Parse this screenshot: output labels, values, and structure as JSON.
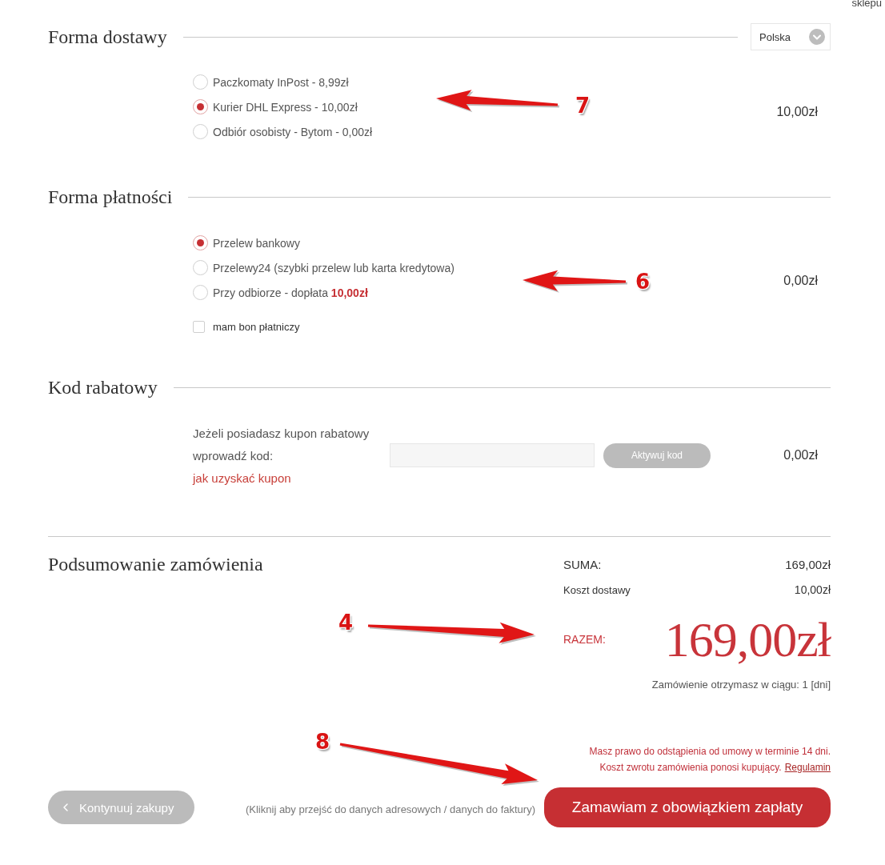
{
  "top_link": "sklepu",
  "delivery": {
    "title": "Forma dostawy",
    "country": "Polska",
    "options": [
      {
        "label": "Paczkomaty InPost - 8,99zł",
        "selected": false
      },
      {
        "label": "Kurier DHL Express - 10,00zł",
        "selected": true
      },
      {
        "label": "Odbiór osobisty - Bytom - 0,00zł",
        "selected": false
      }
    ],
    "price": "10,00zł"
  },
  "payment": {
    "title": "Forma płatności",
    "options": [
      {
        "label": "Przelew bankowy",
        "selected": true
      },
      {
        "label": "Przelewy24 (szybki przelew lub karta kredytowa)",
        "selected": false
      },
      {
        "label": "Przy odbiorze - dopłata **10,00zł**",
        "selected": false
      }
    ],
    "voucher": {
      "label": "mam bon płatniczy",
      "checked": false
    },
    "price": "0,00zł"
  },
  "discount": {
    "title": "Kod rabatowy",
    "prompt": "Jeżeli posiadasz kupon rabatowy wprowadź kod:",
    "help_link": "jak uzyskać kupon",
    "button": "Aktywuj kod",
    "price": "0,00zł"
  },
  "summary": {
    "title": "Podsumowanie zamówienia",
    "rows": [
      {
        "kind": "subtotal",
        "label": "SUMA:",
        "value": "169,00zł"
      },
      {
        "kind": "shipping",
        "label": "Koszt dostawy",
        "value": "10,00zł"
      }
    ],
    "total_label": "RAZEM:",
    "total": "169,00zł",
    "delivery_time": "Zamówienie otrzymasz w ciągu: 1 [dni]"
  },
  "terms": {
    "line_1": "Masz prawo do odstąpienia od umowy w terminie 14 dni.",
    "line_2": "Koszt zwrotu zamówienia ponosi kupujący.",
    "link": "Regulamin"
  },
  "footer": {
    "back_button": "Kontynuuj zakupy",
    "hint": "(Kliknij aby przejść do danych adresowych / danych do faktury)",
    "order_button": "Zamawiam z obowiązkiem zapłaty"
  },
  "annotations": [
    {
      "label": "7"
    },
    {
      "label": "6"
    },
    {
      "label": "4"
    },
    {
      "label": "8"
    }
  ]
}
